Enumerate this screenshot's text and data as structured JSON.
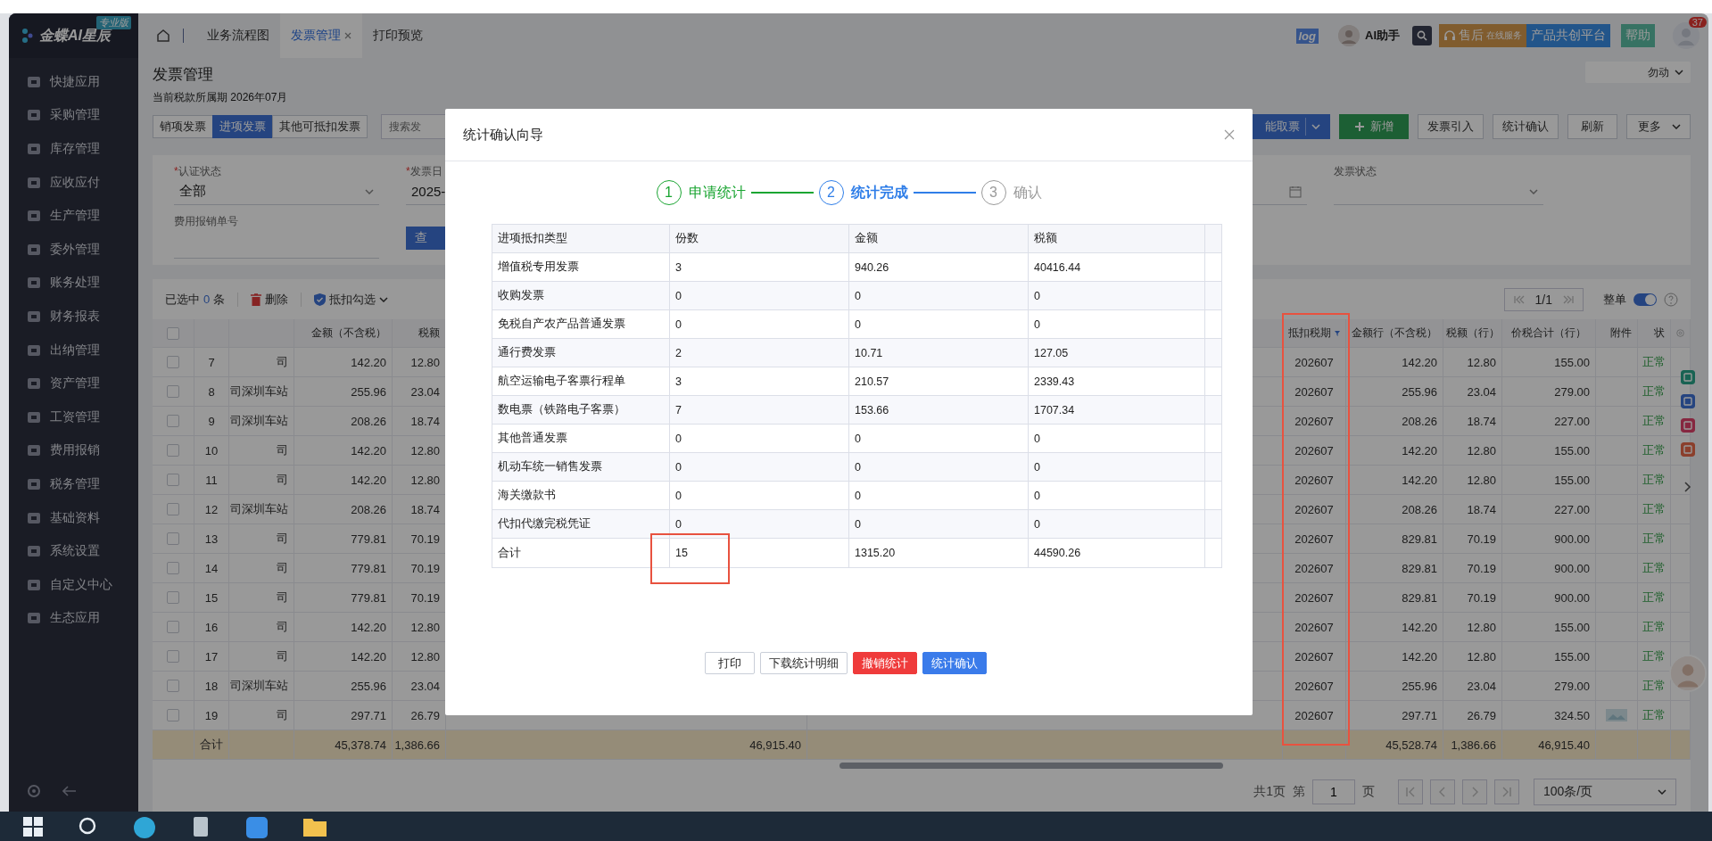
{
  "app": {
    "logo": "金蝶AI星辰",
    "edition": "专业版"
  },
  "sidebar": {
    "items": [
      "快捷应用",
      "采购管理",
      "库存管理",
      "应收应付",
      "生产管理",
      "委外管理",
      "账务处理",
      "财务报表",
      "出纳管理",
      "资产管理",
      "工资管理",
      "费用报销",
      "税务管理",
      "基础资料",
      "系统设置",
      "自定义中心",
      "生态应用"
    ]
  },
  "top_tabs": [
    {
      "label": "业务流程图",
      "selected": false,
      "closable": false
    },
    {
      "label": "发票管理",
      "selected": true,
      "closable": true
    },
    {
      "label": "打印预览",
      "selected": false,
      "closable": false
    }
  ],
  "header": {
    "log": "log",
    "assistant": "AI助手",
    "service": "售后",
    "service_sub": "在线服务",
    "platform": "产品共创平台",
    "help": "帮助",
    "notifications": "37"
  },
  "page": {
    "title": "发票管理",
    "period": "当前税款所属期 2026年07月",
    "org_select": "勿动"
  },
  "invoice_tabs": [
    {
      "label": "销项发票",
      "selected": false
    },
    {
      "label": "进项发票",
      "selected": true
    },
    {
      "label": "其他可抵扣发票",
      "selected": false
    }
  ],
  "search": {
    "placeholder": "搜索发"
  },
  "actions": [
    {
      "label": "能取票",
      "kind": "split"
    },
    {
      "label": "新增",
      "kind": "add"
    },
    {
      "label": "发票引入",
      "kind": "default"
    },
    {
      "label": "统计确认",
      "kind": "default"
    },
    {
      "label": "刷新",
      "kind": "default"
    },
    {
      "label": "更多",
      "kind": "dropdown"
    }
  ],
  "filters": [
    {
      "marker": "*",
      "label": "认证状态",
      "value": "全部",
      "kind": "select"
    },
    {
      "marker": "*",
      "label": "发票日",
      "value": "2025-",
      "kind": "date"
    },
    {
      "label": "发票状态",
      "kind": "select"
    },
    {
      "label": "费用报销单号",
      "kind": "text"
    }
  ],
  "query_button": "查",
  "toolbar": {
    "selected_prefix": "已选中",
    "selected_count": "0",
    "selected_suffix": "条",
    "delete": "删除",
    "deduct": "抵扣勾选",
    "page": "1/1",
    "whole_label": "整单",
    "whole_on": true
  },
  "table": {
    "all_checked": false,
    "columns": [
      {
        "label": "金额（不含税）",
        "filtered": false
      },
      {
        "label": "税额",
        "filtered": false
      },
      {
        "label": "抵扣税期",
        "filtered": true
      },
      {
        "label": "金额行（不含税）",
        "filtered": false
      },
      {
        "label": "税额（行）",
        "filtered": false
      },
      {
        "label": "价税合计（行）",
        "filtered": false
      },
      {
        "label": "附件",
        "filtered": false
      },
      {
        "label": "状",
        "filtered": false
      }
    ],
    "rows": [
      {
        "checked": false,
        "no": "7",
        "name": "司",
        "amount": "142.20",
        "tax": "12.80",
        "period": "202607",
        "row_amount": "142.20",
        "row_tax": "12.80",
        "row_total": "155.00",
        "attachment": false,
        "status": "正常"
      },
      {
        "checked": false,
        "no": "8",
        "name": "司深圳车站",
        "amount": "255.96",
        "tax": "23.04",
        "period": "202607",
        "row_amount": "255.96",
        "row_tax": "23.04",
        "row_total": "279.00",
        "attachment": false,
        "status": "正常"
      },
      {
        "checked": false,
        "no": "9",
        "name": "司深圳车站",
        "amount": "208.26",
        "tax": "18.74",
        "period": "202607",
        "row_amount": "208.26",
        "row_tax": "18.74",
        "row_total": "227.00",
        "attachment": false,
        "status": "正常"
      },
      {
        "checked": false,
        "no": "10",
        "name": "司",
        "amount": "142.20",
        "tax": "12.80",
        "period": "202607",
        "row_amount": "142.20",
        "row_tax": "12.80",
        "row_total": "155.00",
        "attachment": false,
        "status": "正常"
      },
      {
        "checked": false,
        "no": "11",
        "name": "司",
        "amount": "142.20",
        "tax": "12.80",
        "period": "202607",
        "row_amount": "142.20",
        "row_tax": "12.80",
        "row_total": "155.00",
        "attachment": false,
        "status": "正常"
      },
      {
        "checked": false,
        "no": "12",
        "name": "司深圳车站",
        "amount": "208.26",
        "tax": "18.74",
        "period": "202607",
        "row_amount": "208.26",
        "row_tax": "18.74",
        "row_total": "227.00",
        "attachment": false,
        "status": "正常"
      },
      {
        "checked": false,
        "no": "13",
        "name": "司",
        "amount": "779.81",
        "tax": "70.19",
        "period": "202607",
        "row_amount": "829.81",
        "row_tax": "70.19",
        "row_total": "900.00",
        "attachment": false,
        "status": "正常"
      },
      {
        "checked": false,
        "no": "14",
        "name": "司",
        "amount": "779.81",
        "tax": "70.19",
        "period": "202607",
        "row_amount": "829.81",
        "row_tax": "70.19",
        "row_total": "900.00",
        "attachment": false,
        "status": "正常"
      },
      {
        "checked": false,
        "no": "15",
        "name": "司",
        "amount": "779.81",
        "tax": "70.19",
        "period": "202607",
        "row_amount": "829.81",
        "row_tax": "70.19",
        "row_total": "900.00",
        "attachment": false,
        "status": "正常"
      },
      {
        "checked": false,
        "no": "16",
        "name": "司",
        "amount": "142.20",
        "tax": "12.80",
        "period": "202607",
        "row_amount": "142.20",
        "row_tax": "12.80",
        "row_total": "155.00",
        "attachment": false,
        "status": "正常"
      },
      {
        "checked": false,
        "no": "17",
        "name": "司",
        "amount": "142.20",
        "tax": "12.80",
        "period": "202607",
        "row_amount": "142.20",
        "row_tax": "12.80",
        "row_total": "155.00",
        "attachment": false,
        "status": "正常"
      },
      {
        "checked": false,
        "no": "18",
        "name": "司深圳车站",
        "amount": "255.96",
        "tax": "23.04",
        "period": "202607",
        "row_amount": "255.96",
        "row_tax": "23.04",
        "row_total": "279.00",
        "attachment": false,
        "status": "正常"
      },
      {
        "checked": false,
        "no": "19",
        "name": "司",
        "amount": "297.71",
        "tax": "26.79",
        "period": "202607",
        "row_amount": "297.71",
        "row_tax": "26.79",
        "row_total": "324.50",
        "attachment": true,
        "status": "正常"
      }
    ],
    "total": {
      "label": "合计",
      "amount": "45,378.74",
      "tax": "1,386.66",
      "mid_total": "46,915.40",
      "row_amount": "45,528.74",
      "row_tax": "1,386.66",
      "row_total": "46,915.40"
    }
  },
  "pager": {
    "total": "共1页",
    "page_prefix": "第",
    "page": "1",
    "page_suffix": "页",
    "size": "100条/页"
  },
  "modal": {
    "title": "统计确认向导",
    "steps": [
      {
        "number": "1",
        "label": "申请统计",
        "completed": true,
        "selected": false
      },
      {
        "number": "2",
        "label": "统计完成",
        "completed": false,
        "selected": true
      },
      {
        "number": "3",
        "label": "确认",
        "completed": false,
        "selected": false
      }
    ],
    "columns": [
      "进项抵扣类型",
      "份数",
      "金额",
      "税额"
    ],
    "rows": [
      [
        "增值税专用发票",
        "3",
        "940.26",
        "40416.44"
      ],
      [
        "收购发票",
        "0",
        "0",
        "0"
      ],
      [
        "免税自产农产品普通发票",
        "0",
        "0",
        "0"
      ],
      [
        "通行费发票",
        "2",
        "10.71",
        "127.05"
      ],
      [
        "航空运输电子客票行程单",
        "3",
        "210.57",
        "2339.43"
      ],
      [
        "数电票（铁路电子客票）",
        "7",
        "153.66",
        "1707.34"
      ],
      [
        "其他普通发票",
        "0",
        "0",
        "0"
      ],
      [
        "机动车统一销售发票",
        "0",
        "0",
        "0"
      ],
      [
        "海关缴款书",
        "0",
        "0",
        "0"
      ],
      [
        "代扣代缴完税凭证",
        "0",
        "0",
        "0"
      ]
    ],
    "total": [
      "合计",
      "15",
      "1315.20",
      "44590.26"
    ],
    "buttons": [
      {
        "label": "打印",
        "kind": "default"
      },
      {
        "label": "下载统计明细",
        "kind": "default"
      },
      {
        "label": "撤销统计",
        "kind": "danger"
      },
      {
        "label": "统计确认",
        "kind": "primary"
      }
    ]
  }
}
